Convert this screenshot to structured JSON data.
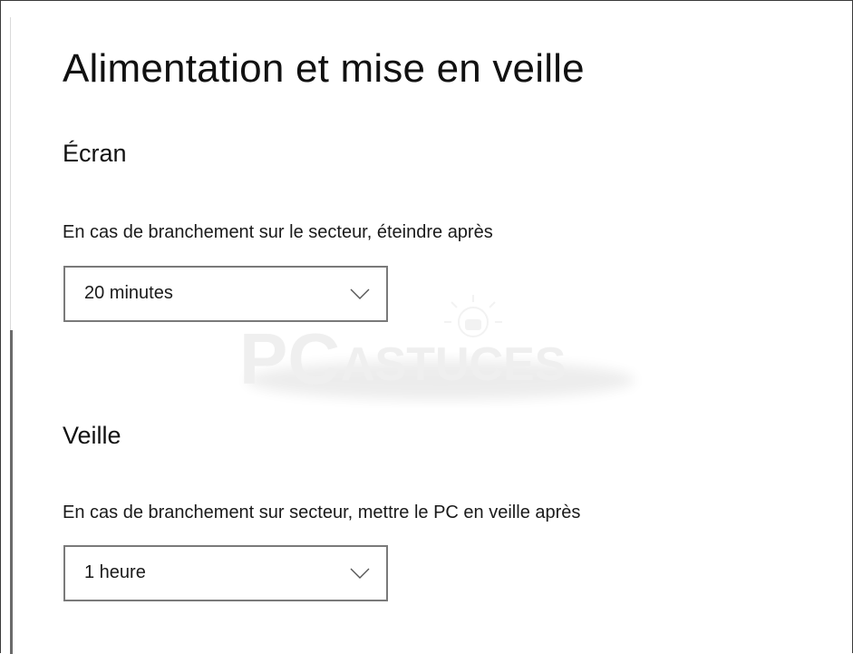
{
  "page": {
    "title": "Alimentation et mise en veille"
  },
  "screen_section": {
    "title": "Écran",
    "label": "En cas de branchement sur le secteur, éteindre après",
    "selected": "20 minutes"
  },
  "sleep_section": {
    "title": "Veille",
    "label": "En cas de branchement sur secteur, mettre le PC en veille après",
    "selected": "1 heure"
  },
  "watermark": {
    "text_pc": "PC",
    "text_astuces": "ASTUCES"
  },
  "icons": {
    "dropdown": "chevron-down-icon",
    "watermark": "lightbulb-icon"
  },
  "colors": {
    "border": "#7a7a7a",
    "text": "#1a1a1a",
    "scrollbar": "#6b6b6b"
  }
}
